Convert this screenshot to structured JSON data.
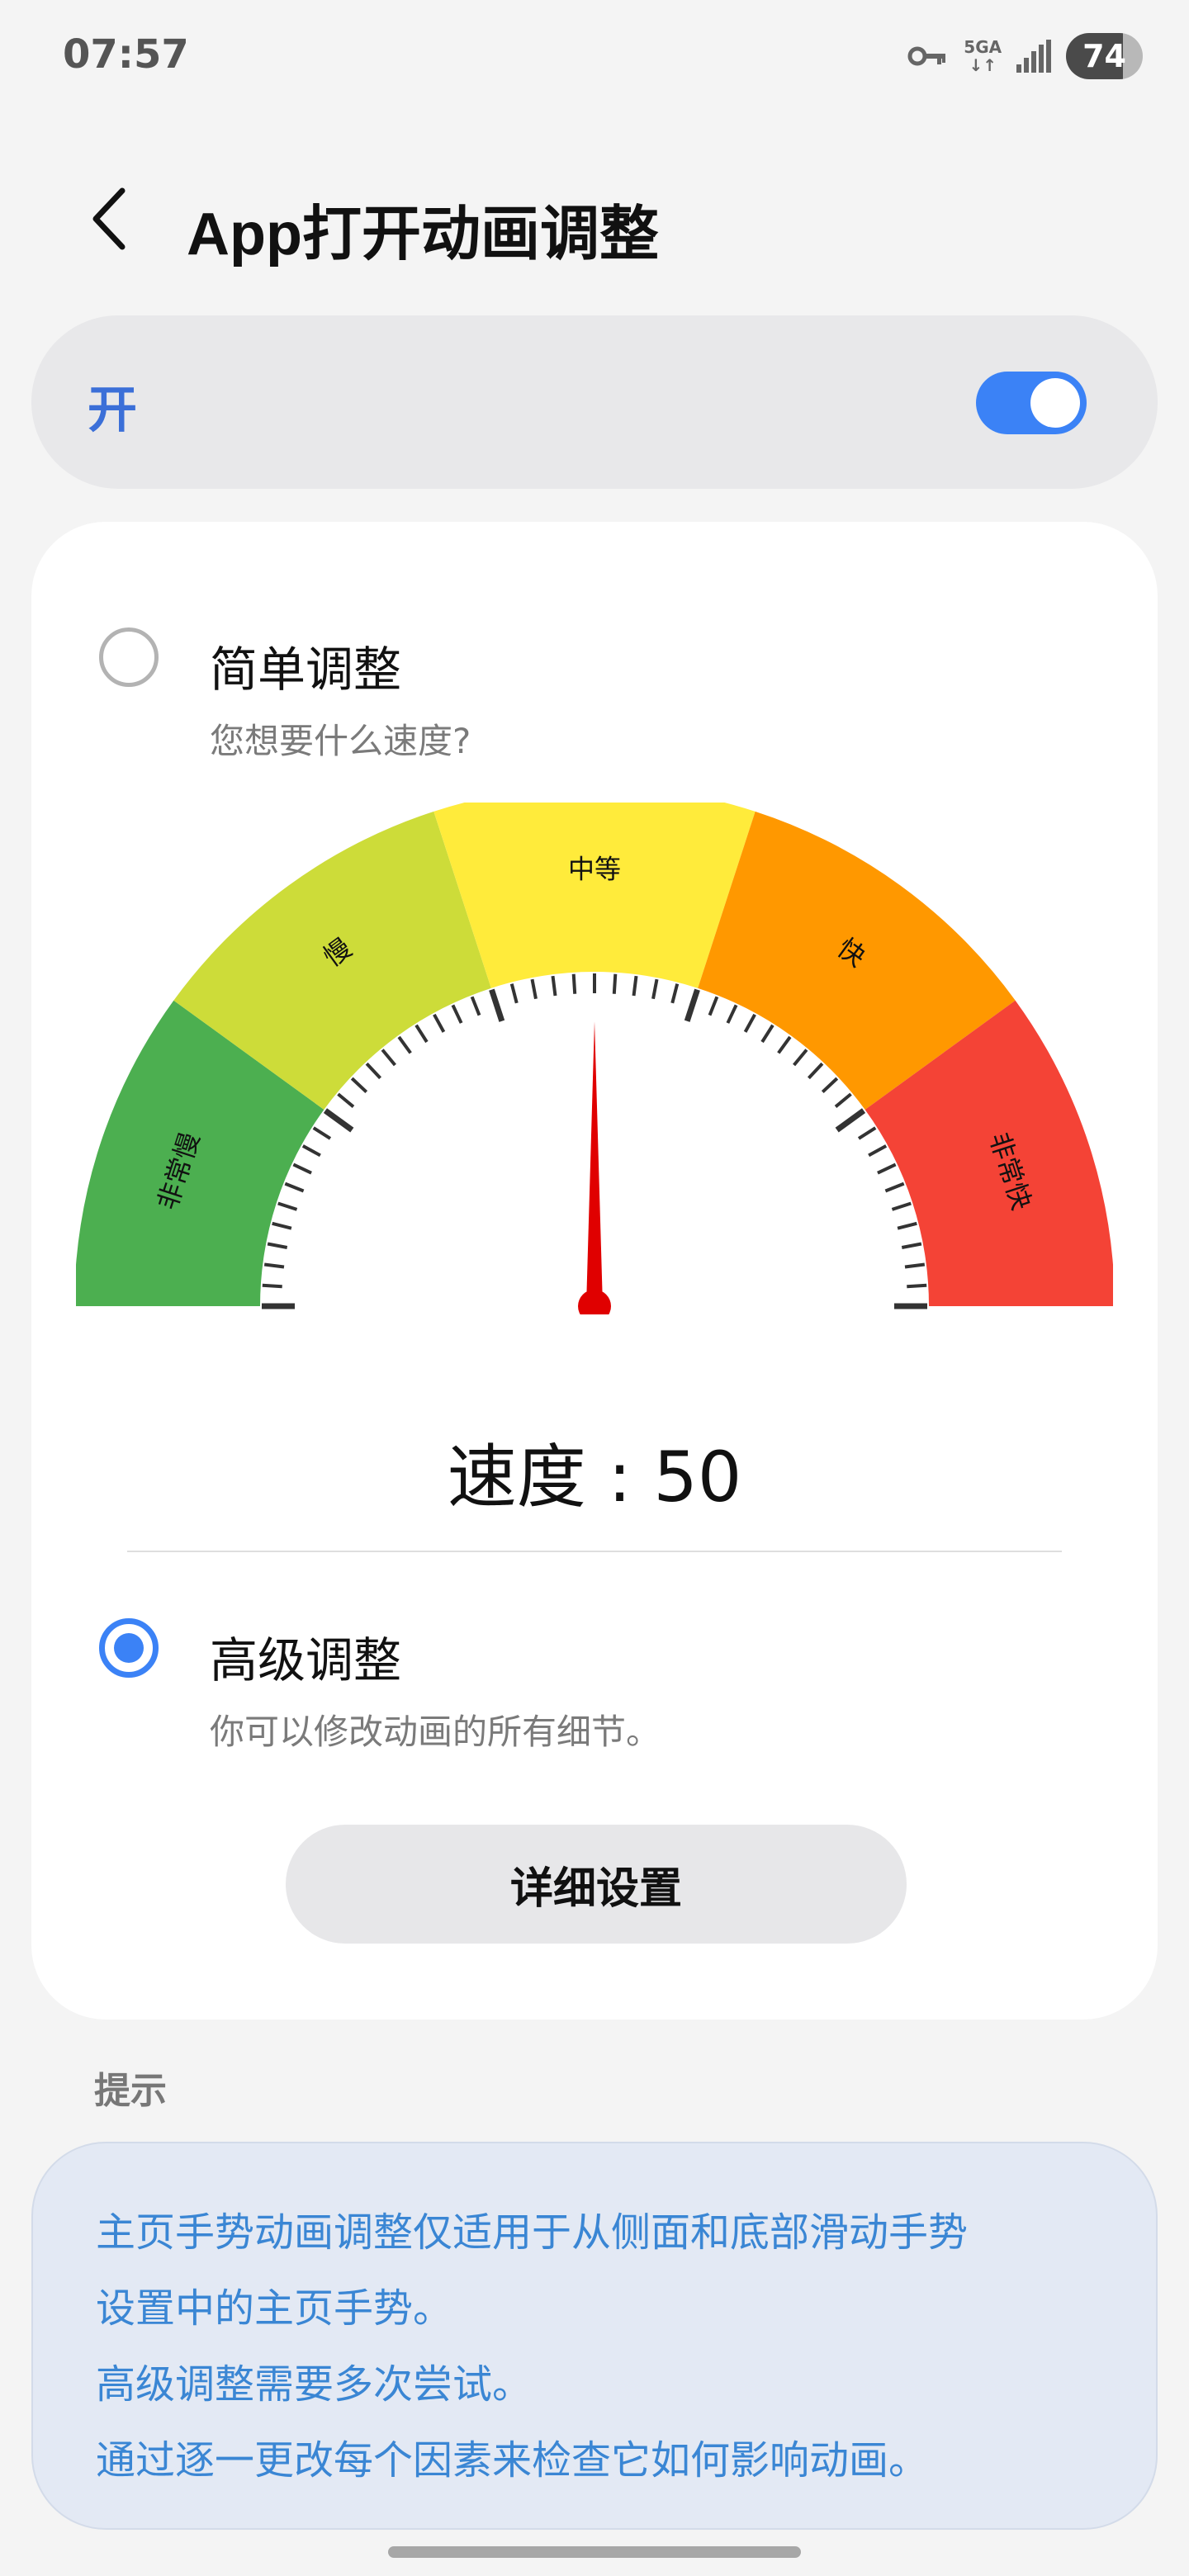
{
  "status_bar": {
    "time": "07:57",
    "network_type": "5GA",
    "battery": "74",
    "icons": [
      "key-icon",
      "data-arrows-icon",
      "signal-icon",
      "battery-icon"
    ]
  },
  "header": {
    "back_icon": "chevron-left-icon",
    "title": "App打开动画调整"
  },
  "master_toggle": {
    "label": "开",
    "state": true,
    "accent_color": "#3b82f6"
  },
  "simple_adjust": {
    "title": "简单调整",
    "subtitle": "您想要什么速度?",
    "selected": false
  },
  "gauge": {
    "segments": [
      {
        "label": "非常慢",
        "color": "#4caf50"
      },
      {
        "label": "慢",
        "color": "#cddc39"
      },
      {
        "label": "中等",
        "color": "#ffeb3b"
      },
      {
        "label": "快",
        "color": "#ff9800"
      },
      {
        "label": "非常快",
        "color": "#f44336"
      }
    ],
    "min": 0,
    "max": 100,
    "value": 50,
    "needle_color": "#e00000"
  },
  "speed_readout": "速度 : 50",
  "advanced_adjust": {
    "title": "高级调整",
    "subtitle": "你可以修改动画的所有细节。",
    "selected": true
  },
  "detail_button": "详细设置",
  "tips": {
    "heading": "提示",
    "lines": [
      "主页手势动画调整仅适用于从侧面和底部滑动手势",
      "设置中的主页手势。",
      "高级调整需要多次尝试。",
      "通过逐一更改每个因素来检查它如何影响动画。"
    ]
  }
}
